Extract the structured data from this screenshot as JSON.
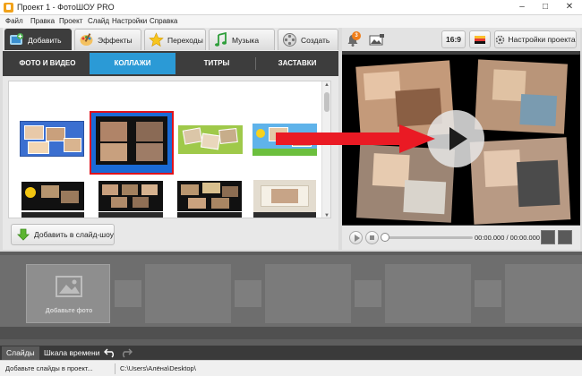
{
  "window": {
    "title": "Проект 1 - ФотоШОУ PRO",
    "minimize": "–",
    "maximize": "□",
    "close": "✕"
  },
  "menu": [
    "Файл",
    "Правка",
    "Проект",
    "Слайд",
    "Настройки",
    "Справка"
  ],
  "top_tabs": [
    {
      "label": "Добавить",
      "icon": "add-photo-icon",
      "active": true
    },
    {
      "label": "Эффекты",
      "icon": "palette-icon",
      "active": false
    },
    {
      "label": "Переходы",
      "icon": "star-icon",
      "active": false
    },
    {
      "label": "Музыка",
      "icon": "music-icon",
      "active": false
    },
    {
      "label": "Создать",
      "icon": "film-reel-icon",
      "active": false
    }
  ],
  "sub_tabs": [
    {
      "label": "ФОТО И ВИДЕО",
      "active": false
    },
    {
      "label": "КОЛЛАЖИ",
      "active": true
    },
    {
      "label": "ТИТРЫ",
      "active": false
    },
    {
      "label": "ЗАСТАВКИ",
      "active": false
    }
  ],
  "gallery": {
    "selected_index": 1,
    "scroll_up": "▲",
    "scroll_down": "▼"
  },
  "add_to_slideshow": "Добавить в слайд-шоу",
  "right_toolbar": {
    "notification_count": "3",
    "aspect_ratio": "16:9",
    "settings_label": "Настройки проекта"
  },
  "player": {
    "time": "00:00.000 / 00:00.000"
  },
  "timeline": {
    "add_photo_label": "Добавьте фото"
  },
  "bottom_tabs": [
    {
      "label": "Слайды",
      "active": true
    },
    {
      "label": "Шкала времени",
      "active": false
    }
  ],
  "status": {
    "left": "Добавьте слайды в проект...",
    "path": "C:\\Users\\Алёна\\Desktop\\"
  },
  "colors": {
    "accent_blue": "#2b9ad6",
    "selection_red": "#e0121b",
    "arrow_red": "#ea1a24",
    "dark_panel": "#3d3d3d"
  }
}
